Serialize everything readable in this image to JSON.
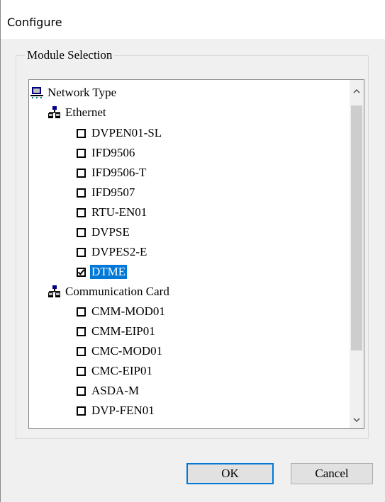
{
  "window": {
    "title": "Configure"
  },
  "group": {
    "label": "Module Selection"
  },
  "tree": {
    "root": {
      "label": "Network Type",
      "icon": "network-computer-icon"
    },
    "categories": [
      {
        "label": "Ethernet",
        "icon": "network-hierarchy-icon",
        "items": [
          {
            "label": "DVPEN01-SL",
            "checked": false
          },
          {
            "label": "IFD9506",
            "checked": false
          },
          {
            "label": "IFD9506-T",
            "checked": false
          },
          {
            "label": "IFD9507",
            "checked": false
          },
          {
            "label": "RTU-EN01",
            "checked": false
          },
          {
            "label": "DVPSE",
            "checked": false
          },
          {
            "label": "DVPES2-E",
            "checked": false
          },
          {
            "label": "DTME",
            "checked": true,
            "selected": true
          }
        ]
      },
      {
        "label": "Communication Card",
        "icon": "network-hierarchy-icon",
        "items": [
          {
            "label": "CMM-MOD01",
            "checked": false
          },
          {
            "label": "CMM-EIP01",
            "checked": false
          },
          {
            "label": "CMC-MOD01",
            "checked": false
          },
          {
            "label": "CMC-EIP01",
            "checked": false
          },
          {
            "label": "ASDA-M",
            "checked": false
          },
          {
            "label": "DVP-FEN01",
            "checked": false
          }
        ]
      }
    ]
  },
  "buttons": {
    "ok": "OK",
    "cancel": "Cancel"
  },
  "colors": {
    "selection": "#0078d7",
    "background": "#f0f0f0"
  }
}
